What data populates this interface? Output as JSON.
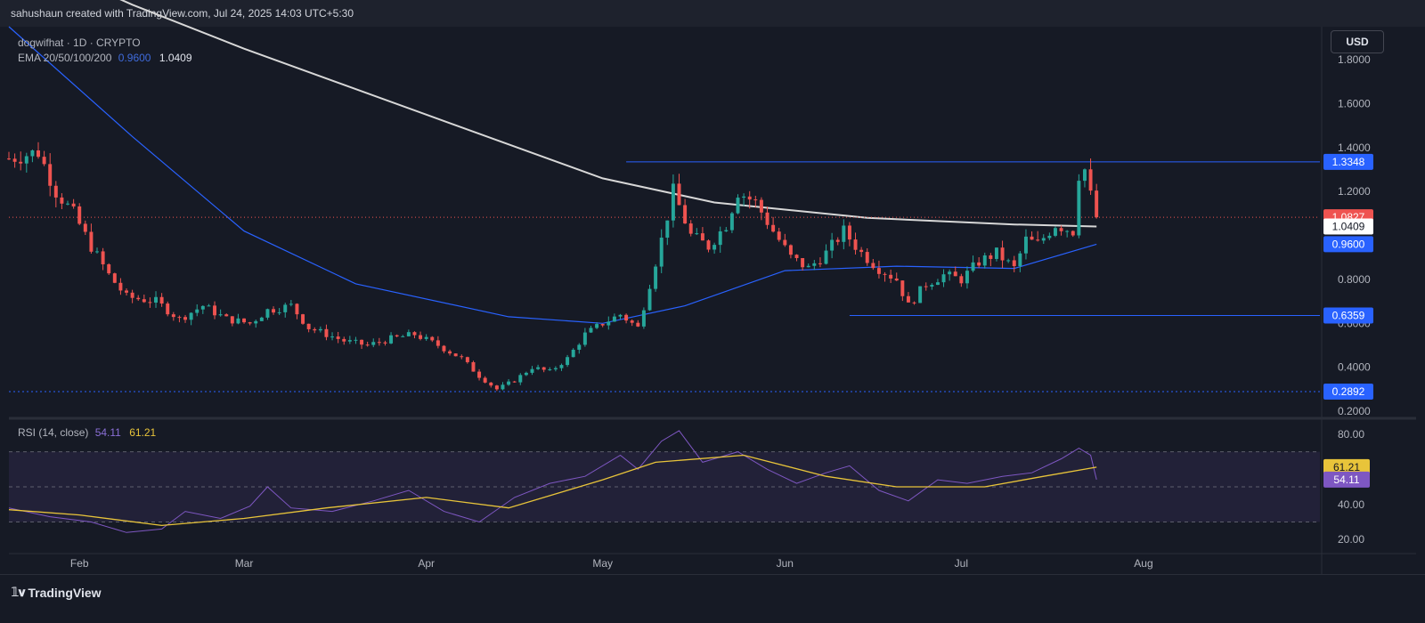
{
  "header": {
    "credit": "sahushaun created with TradingView.com, Jul 24, 2025 14:03 UTC+5:30"
  },
  "legend": {
    "symbol": "dogwifhat · 1D · CRYPTO",
    "ema_label": "EMA 20/50/100/200",
    "ema_val1": "0.9600",
    "ema_val2": "1.0409",
    "rsi_label": "RSI (14, close)",
    "rsi_val": "54.11",
    "rsi_ma_val": "61.21"
  },
  "currency_button": "USD",
  "footer": {
    "brand": "TradingView"
  },
  "colors": {
    "bg": "#161a25",
    "up": "#26a69a",
    "down": "#ef5350",
    "ema_white": "#d7d7d7",
    "ema_blue": "#2962ff",
    "rsi_line": "#7e57c2",
    "rsi_ma": "#e8c43a",
    "level_blue": "#2962ff",
    "price_line": "#ef5350"
  },
  "chart_data": [
    {
      "type": "candlestick",
      "title": "dogwifhat · 1D · CRYPTO",
      "x_type": "date",
      "x_ticks": [
        "Feb",
        "Mar",
        "Apr",
        "May",
        "Jun",
        "Jul",
        "Aug"
      ],
      "x_tick_dates": [
        "2025-02-01",
        "2025-03-01",
        "2025-04-01",
        "2025-05-01",
        "2025-06-01",
        "2025-07-01",
        "2025-08-01"
      ],
      "xlim": [
        "2025-01-20",
        "2025-08-31"
      ],
      "y_ticks": [
        "1.8000",
        "1.6000",
        "1.4000",
        "1.2000",
        "0.8000",
        "0.6000",
        "0.4000",
        "0.2000"
      ],
      "ylim": [
        0.18,
        1.95
      ],
      "series_close": [
        {
          "date": "2025-01-20",
          "close": 1.35
        },
        {
          "date": "2025-01-25",
          "close": 1.38
        },
        {
          "date": "2025-01-28",
          "close": 1.2
        },
        {
          "date": "2025-01-31",
          "close": 1.1
        },
        {
          "date": "2025-02-03",
          "close": 0.95
        },
        {
          "date": "2025-02-06",
          "close": 0.82
        },
        {
          "date": "2025-02-09",
          "close": 0.72
        },
        {
          "date": "2025-02-14",
          "close": 0.7
        },
        {
          "date": "2025-02-18",
          "close": 0.62
        },
        {
          "date": "2025-02-22",
          "close": 0.68
        },
        {
          "date": "2025-02-26",
          "close": 0.62
        },
        {
          "date": "2025-03-02",
          "close": 0.6
        },
        {
          "date": "2025-03-05",
          "close": 0.66
        },
        {
          "date": "2025-03-09",
          "close": 0.68
        },
        {
          "date": "2025-03-12",
          "close": 0.58
        },
        {
          "date": "2025-03-18",
          "close": 0.52
        },
        {
          "date": "2025-03-22",
          "close": 0.5
        },
        {
          "date": "2025-03-26",
          "close": 0.53
        },
        {
          "date": "2025-03-30",
          "close": 0.55
        },
        {
          "date": "2025-04-03",
          "close": 0.5
        },
        {
          "date": "2025-04-07",
          "close": 0.44
        },
        {
          "date": "2025-04-10",
          "close": 0.36
        },
        {
          "date": "2025-04-13",
          "close": 0.3
        },
        {
          "date": "2025-04-16",
          "close": 0.34
        },
        {
          "date": "2025-04-19",
          "close": 0.4
        },
        {
          "date": "2025-04-22",
          "close": 0.38
        },
        {
          "date": "2025-04-25",
          "close": 0.44
        },
        {
          "date": "2025-04-28",
          "close": 0.55
        },
        {
          "date": "2025-05-01",
          "close": 0.6
        },
        {
          "date": "2025-05-04",
          "close": 0.64
        },
        {
          "date": "2025-05-07",
          "close": 0.58
        },
        {
          "date": "2025-05-09",
          "close": 0.78
        },
        {
          "date": "2025-05-11",
          "close": 0.98
        },
        {
          "date": "2025-05-13",
          "close": 1.2
        },
        {
          "date": "2025-05-16",
          "close": 1.0
        },
        {
          "date": "2025-05-19",
          "close": 0.95
        },
        {
          "date": "2025-05-22",
          "close": 1.05
        },
        {
          "date": "2025-05-24",
          "close": 1.2
        },
        {
          "date": "2025-05-27",
          "close": 1.15
        },
        {
          "date": "2025-05-30",
          "close": 1.02
        },
        {
          "date": "2025-06-02",
          "close": 0.9
        },
        {
          "date": "2025-06-05",
          "close": 0.85
        },
        {
          "date": "2025-06-08",
          "close": 0.92
        },
        {
          "date": "2025-06-11",
          "close": 1.02
        },
        {
          "date": "2025-06-14",
          "close": 0.92
        },
        {
          "date": "2025-06-17",
          "close": 0.85
        },
        {
          "date": "2025-06-20",
          "close": 0.8
        },
        {
          "date": "2025-06-22",
          "close": 0.68
        },
        {
          "date": "2025-06-25",
          "close": 0.78
        },
        {
          "date": "2025-06-28",
          "close": 0.82
        },
        {
          "date": "2025-07-01",
          "close": 0.8
        },
        {
          "date": "2025-07-04",
          "close": 0.88
        },
        {
          "date": "2025-07-07",
          "close": 0.92
        },
        {
          "date": "2025-07-10",
          "close": 0.85
        },
        {
          "date": "2025-07-12",
          "close": 0.98
        },
        {
          "date": "2025-07-14",
          "close": 0.96
        },
        {
          "date": "2025-07-17",
          "close": 1.05
        },
        {
          "date": "2025-07-20",
          "close": 1.02
        },
        {
          "date": "2025-07-21",
          "close": 1.28
        },
        {
          "date": "2025-07-22",
          "close": 1.3
        },
        {
          "date": "2025-07-23",
          "close": 1.18
        },
        {
          "date": "2025-07-24",
          "close": 1.0827
        }
      ],
      "ema_series": [
        {
          "name": "EMA 20/50/100/200",
          "color": "#d7d7d7",
          "last": 1.0409,
          "points": [
            {
              "date": "2025-01-20",
              "value": 2.3
            },
            {
              "date": "2025-02-10",
              "value": 2.05
            },
            {
              "date": "2025-03-01",
              "value": 1.85
            },
            {
              "date": "2025-04-01",
              "value": 1.55
            },
            {
              "date": "2025-05-01",
              "value": 1.26
            },
            {
              "date": "2025-05-20",
              "value": 1.15
            },
            {
              "date": "2025-06-15",
              "value": 1.08
            },
            {
              "date": "2025-07-10",
              "value": 1.05
            },
            {
              "date": "2025-07-24",
              "value": 1.0409
            }
          ]
        },
        {
          "name": "",
          "color": "#2962ff",
          "last": 0.96,
          "points": [
            {
              "date": "2025-01-20",
              "value": 1.95
            },
            {
              "date": "2025-02-10",
              "value": 1.45
            },
            {
              "date": "2025-03-01",
              "value": 1.02
            },
            {
              "date": "2025-03-20",
              "value": 0.78
            },
            {
              "date": "2025-04-15",
              "value": 0.63
            },
            {
              "date": "2025-05-01",
              "value": 0.6
            },
            {
              "date": "2025-05-15",
              "value": 0.68
            },
            {
              "date": "2025-06-01",
              "value": 0.84
            },
            {
              "date": "2025-06-20",
              "value": 0.86
            },
            {
              "date": "2025-07-10",
              "value": 0.85
            },
            {
              "date": "2025-07-24",
              "value": 0.96
            }
          ]
        }
      ],
      "levels": [
        {
          "value": 1.3348,
          "label": "1.3348",
          "from": "2025-05-05",
          "style": "solid"
        },
        {
          "value": 0.6359,
          "label": "0.6359",
          "from": "2025-06-12",
          "style": "solid"
        },
        {
          "value": 0.2892,
          "label": "0.2892",
          "from": "2025-01-20",
          "style": "dotted"
        },
        {
          "value": 1.0827,
          "label": "1.0827",
          "from": "2025-01-20",
          "style": "dotted-red"
        }
      ],
      "price_labels": [
        {
          "value": 1.0409,
          "label": "1.0409",
          "bg": "#ffffff",
          "fg": "#131722"
        },
        {
          "value": 0.96,
          "label": "0.9600",
          "bg": "#2962ff",
          "fg": "#ffffff"
        }
      ]
    },
    {
      "type": "line",
      "title": "RSI (14, close)",
      "y_ticks": [
        "80.00",
        "40.00",
        "20.00"
      ],
      "ylim": [
        12,
        86
      ],
      "bands": [
        30,
        50,
        70
      ],
      "series": [
        {
          "name": "RSI (14, close)",
          "color": "#7e57c2",
          "last": 54.11,
          "points": [
            {
              "date": "2025-01-20",
              "value": 38
            },
            {
              "date": "2025-01-27",
              "value": 33
            },
            {
              "date": "2025-02-03",
              "value": 30
            },
            {
              "date": "2025-02-09",
              "value": 24
            },
            {
              "date": "2025-02-15",
              "value": 26
            },
            {
              "date": "2025-02-19",
              "value": 36
            },
            {
              "date": "2025-02-25",
              "value": 32
            },
            {
              "date": "2025-03-02",
              "value": 39
            },
            {
              "date": "2025-03-05",
              "value": 50
            },
            {
              "date": "2025-03-09",
              "value": 38
            },
            {
              "date": "2025-03-16",
              "value": 36
            },
            {
              "date": "2025-03-23",
              "value": 42
            },
            {
              "date": "2025-03-29",
              "value": 48
            },
            {
              "date": "2025-04-04",
              "value": 36
            },
            {
              "date": "2025-04-10",
              "value": 30
            },
            {
              "date": "2025-04-16",
              "value": 44
            },
            {
              "date": "2025-04-22",
              "value": 52
            },
            {
              "date": "2025-04-28",
              "value": 56
            },
            {
              "date": "2025-05-04",
              "value": 68
            },
            {
              "date": "2025-05-07",
              "value": 60
            },
            {
              "date": "2025-05-11",
              "value": 76
            },
            {
              "date": "2025-05-14",
              "value": 82
            },
            {
              "date": "2025-05-18",
              "value": 64
            },
            {
              "date": "2025-05-24",
              "value": 70
            },
            {
              "date": "2025-05-29",
              "value": 60
            },
            {
              "date": "2025-06-03",
              "value": 52
            },
            {
              "date": "2025-06-08",
              "value": 58
            },
            {
              "date": "2025-06-12",
              "value": 62
            },
            {
              "date": "2025-06-17",
              "value": 48
            },
            {
              "date": "2025-06-22",
              "value": 42
            },
            {
              "date": "2025-06-27",
              "value": 54
            },
            {
              "date": "2025-07-02",
              "value": 52
            },
            {
              "date": "2025-07-08",
              "value": 56
            },
            {
              "date": "2025-07-13",
              "value": 58
            },
            {
              "date": "2025-07-18",
              "value": 66
            },
            {
              "date": "2025-07-21",
              "value": 72
            },
            {
              "date": "2025-07-23",
              "value": 68
            },
            {
              "date": "2025-07-24",
              "value": 54.11
            }
          ]
        },
        {
          "name": "",
          "color": "#e8c43a",
          "last": 61.21,
          "points": [
            {
              "date": "2025-01-20",
              "value": 37
            },
            {
              "date": "2025-02-01",
              "value": 34
            },
            {
              "date": "2025-02-15",
              "value": 28
            },
            {
              "date": "2025-03-01",
              "value": 32
            },
            {
              "date": "2025-03-15",
              "value": 38
            },
            {
              "date": "2025-04-01",
              "value": 44
            },
            {
              "date": "2025-04-15",
              "value": 38
            },
            {
              "date": "2025-05-01",
              "value": 54
            },
            {
              "date": "2025-05-10",
              "value": 64
            },
            {
              "date": "2025-05-25",
              "value": 68
            },
            {
              "date": "2025-06-08",
              "value": 56
            },
            {
              "date": "2025-06-20",
              "value": 50
            },
            {
              "date": "2025-07-05",
              "value": 50
            },
            {
              "date": "2025-07-15",
              "value": 56
            },
            {
              "date": "2025-07-24",
              "value": 61.21
            }
          ]
        }
      ]
    }
  ]
}
